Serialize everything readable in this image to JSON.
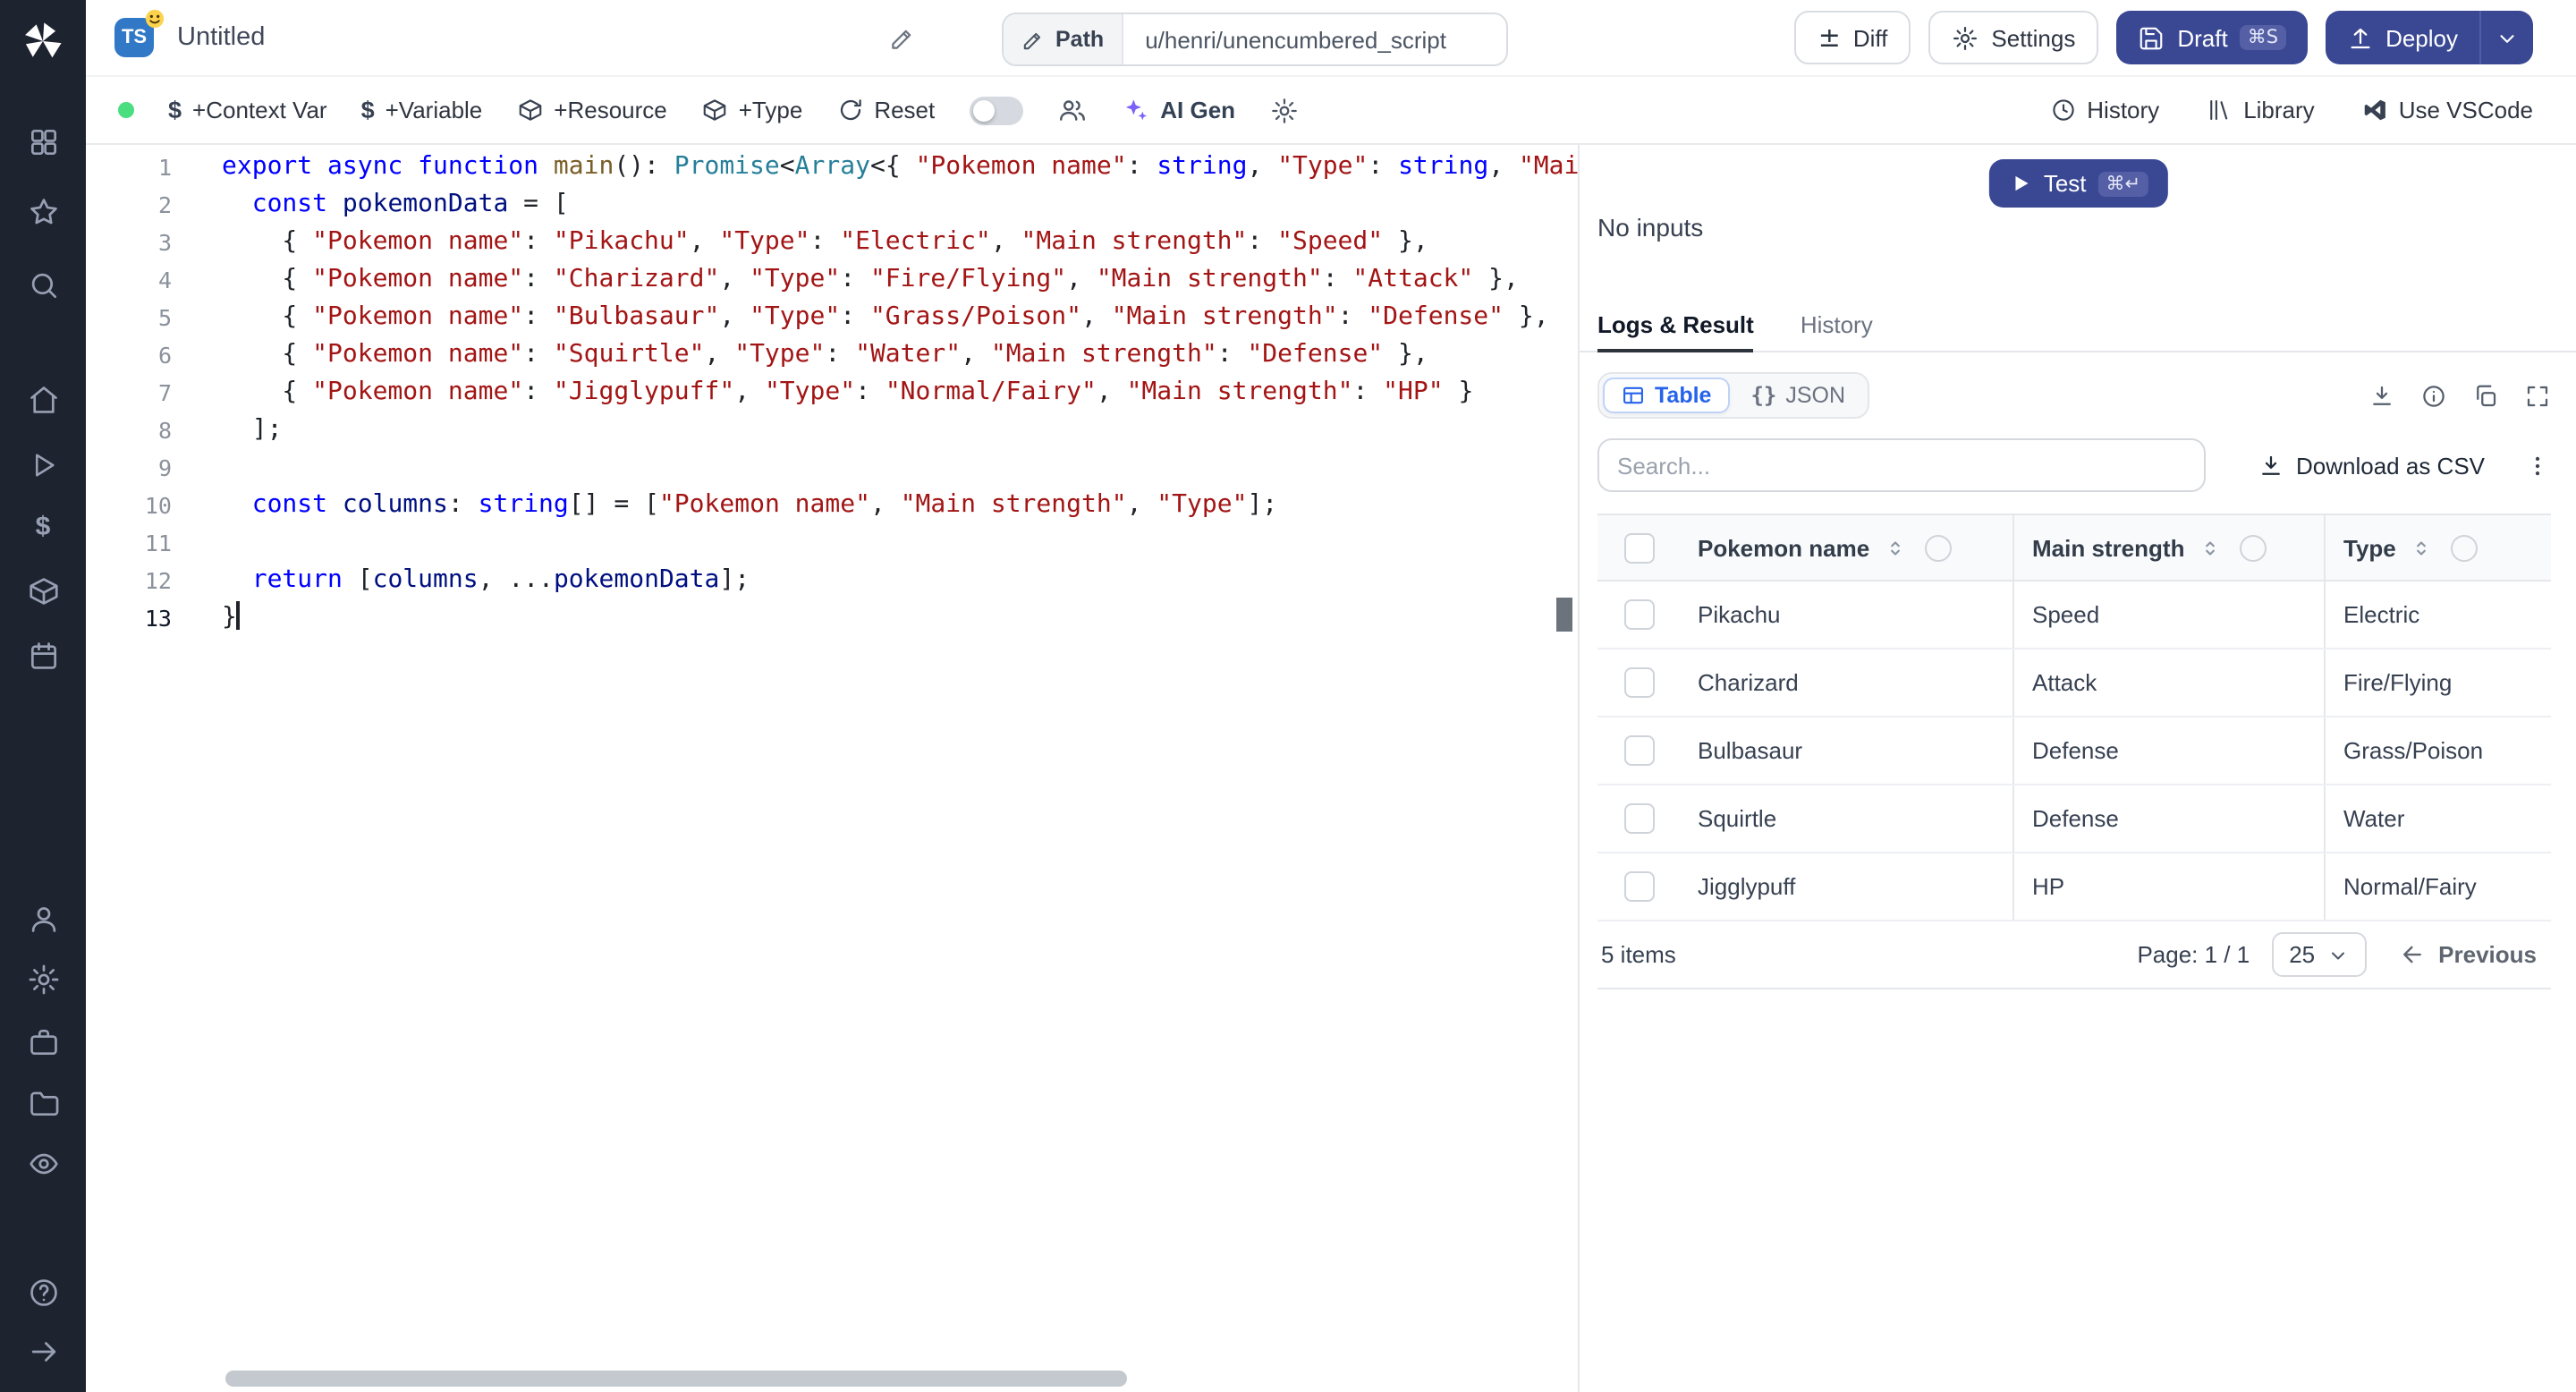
{
  "topbar": {
    "lang_badge": "TS",
    "title": "Untitled",
    "path_label": "Path",
    "path_value": "u/henri/unencumbered_script",
    "diff": "Diff",
    "settings": "Settings",
    "draft": "Draft",
    "draft_shortcut": "⌘S",
    "deploy": "Deploy"
  },
  "toolbar": {
    "context_var": "+Context Var",
    "variable": "+Variable",
    "resource": "+Resource",
    "type": "+Type",
    "reset": "Reset",
    "ai_gen": "AI Gen",
    "history": "History",
    "library": "Library",
    "use_vscode": "Use VSCode"
  },
  "sidebar": {
    "icons": [
      "windmill-logo",
      "apps-icon",
      "star-icon",
      "search-icon",
      "home-icon",
      "play-icon",
      "dollar-icon",
      "package-icon",
      "calendar-icon",
      "user-icon",
      "gear-icon",
      "briefcase-icon",
      "folder-icon",
      "eye-icon",
      "help-icon",
      "arrow-right-icon"
    ]
  },
  "editor": {
    "cursor_line": 13,
    "lines": [
      [
        [
          "k",
          "export async function "
        ],
        [
          "f",
          "main"
        ],
        [
          "p",
          "(): "
        ],
        [
          "t",
          "Promise"
        ],
        [
          "p",
          "<"
        ],
        [
          "t",
          "Array"
        ],
        [
          "p",
          "<{ "
        ],
        [
          "s",
          "\"Pokemon name\""
        ],
        [
          "p",
          ": "
        ],
        [
          "k",
          "string"
        ],
        [
          "p",
          ", "
        ],
        [
          "s",
          "\"Type\""
        ],
        [
          "p",
          ": "
        ],
        [
          "k",
          "string"
        ],
        [
          "p",
          ", "
        ],
        [
          "s",
          "\"Mai"
        ]
      ],
      [
        [
          "p",
          "  "
        ],
        [
          "k",
          "const "
        ],
        [
          "v",
          "pokemonData"
        ],
        [
          "p",
          " = ["
        ]
      ],
      [
        [
          "p",
          "    { "
        ],
        [
          "s",
          "\"Pokemon name\""
        ],
        [
          "p",
          ": "
        ],
        [
          "s",
          "\"Pikachu\""
        ],
        [
          "p",
          ", "
        ],
        [
          "s",
          "\"Type\""
        ],
        [
          "p",
          ": "
        ],
        [
          "s",
          "\"Electric\""
        ],
        [
          "p",
          ", "
        ],
        [
          "s",
          "\"Main strength\""
        ],
        [
          "p",
          ": "
        ],
        [
          "s",
          "\"Speed\""
        ],
        [
          "p",
          " },"
        ]
      ],
      [
        [
          "p",
          "    { "
        ],
        [
          "s",
          "\"Pokemon name\""
        ],
        [
          "p",
          ": "
        ],
        [
          "s",
          "\"Charizard\""
        ],
        [
          "p",
          ", "
        ],
        [
          "s",
          "\"Type\""
        ],
        [
          "p",
          ": "
        ],
        [
          "s",
          "\"Fire/Flying\""
        ],
        [
          "p",
          ", "
        ],
        [
          "s",
          "\"Main strength\""
        ],
        [
          "p",
          ": "
        ],
        [
          "s",
          "\"Attack\""
        ],
        [
          "p",
          " },"
        ]
      ],
      [
        [
          "p",
          "    { "
        ],
        [
          "s",
          "\"Pokemon name\""
        ],
        [
          "p",
          ": "
        ],
        [
          "s",
          "\"Bulbasaur\""
        ],
        [
          "p",
          ", "
        ],
        [
          "s",
          "\"Type\""
        ],
        [
          "p",
          ": "
        ],
        [
          "s",
          "\"Grass/Poison\""
        ],
        [
          "p",
          ", "
        ],
        [
          "s",
          "\"Main strength\""
        ],
        [
          "p",
          ": "
        ],
        [
          "s",
          "\"Defense\""
        ],
        [
          "p",
          " },"
        ]
      ],
      [
        [
          "p",
          "    { "
        ],
        [
          "s",
          "\"Pokemon name\""
        ],
        [
          "p",
          ": "
        ],
        [
          "s",
          "\"Squirtle\""
        ],
        [
          "p",
          ", "
        ],
        [
          "s",
          "\"Type\""
        ],
        [
          "p",
          ": "
        ],
        [
          "s",
          "\"Water\""
        ],
        [
          "p",
          ", "
        ],
        [
          "s",
          "\"Main strength\""
        ],
        [
          "p",
          ": "
        ],
        [
          "s",
          "\"Defense\""
        ],
        [
          "p",
          " },"
        ]
      ],
      [
        [
          "p",
          "    { "
        ],
        [
          "s",
          "\"Pokemon name\""
        ],
        [
          "p",
          ": "
        ],
        [
          "s",
          "\"Jigglypuff\""
        ],
        [
          "p",
          ", "
        ],
        [
          "s",
          "\"Type\""
        ],
        [
          "p",
          ": "
        ],
        [
          "s",
          "\"Normal/Fairy\""
        ],
        [
          "p",
          ", "
        ],
        [
          "s",
          "\"Main strength\""
        ],
        [
          "p",
          ": "
        ],
        [
          "s",
          "\"HP\""
        ],
        [
          "p",
          " }"
        ]
      ],
      [
        [
          "p",
          "  ];"
        ]
      ],
      [],
      [
        [
          "p",
          "  "
        ],
        [
          "k",
          "const "
        ],
        [
          "v",
          "columns"
        ],
        [
          "p",
          ": "
        ],
        [
          "k",
          "string"
        ],
        [
          "p",
          "[] = ["
        ],
        [
          "s",
          "\"Pokemon name\""
        ],
        [
          "p",
          ", "
        ],
        [
          "s",
          "\"Main strength\""
        ],
        [
          "p",
          ", "
        ],
        [
          "s",
          "\"Type\""
        ],
        [
          "p",
          "];"
        ]
      ],
      [],
      [
        [
          "p",
          "  "
        ],
        [
          "k",
          "return"
        ],
        [
          "p",
          " ["
        ],
        [
          "v",
          "columns"
        ],
        [
          "p",
          ", ..."
        ],
        [
          "v",
          "pokemonData"
        ],
        [
          "p",
          "];"
        ]
      ],
      [
        [
          "p",
          "}"
        ]
      ]
    ]
  },
  "panel": {
    "test": "Test",
    "test_shortcut": "⌘↵",
    "no_inputs": "No inputs",
    "tabs": {
      "logs": "Logs & Result",
      "history": "History"
    },
    "view_toggle": {
      "table": "Table",
      "json": "JSON"
    },
    "search_placeholder": "Search...",
    "download_csv": "Download as CSV",
    "table": {
      "columns": [
        "Pokemon name",
        "Main strength",
        "Type"
      ],
      "rows": [
        {
          "name": "Pikachu",
          "strength": "Speed",
          "type": "Electric"
        },
        {
          "name": "Charizard",
          "strength": "Attack",
          "type": "Fire/Flying"
        },
        {
          "name": "Bulbasaur",
          "strength": "Defense",
          "type": "Grass/Poison"
        },
        {
          "name": "Squirtle",
          "strength": "Defense",
          "type": "Water"
        },
        {
          "name": "Jigglypuff",
          "strength": "HP",
          "type": "Normal/Fairy"
        }
      ],
      "footer": {
        "items": "5 items",
        "page": "Page: 1 / 1",
        "page_size": "25",
        "previous": "Previous"
      }
    }
  }
}
